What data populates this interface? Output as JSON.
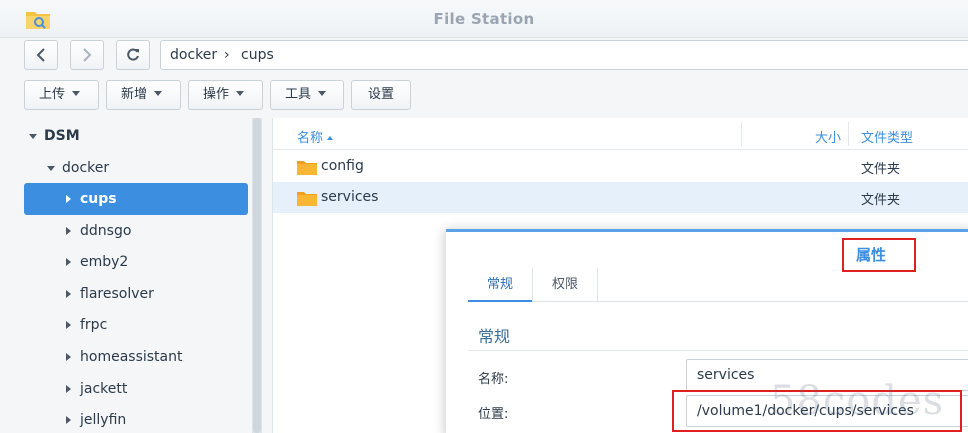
{
  "app": {
    "title": "File Station"
  },
  "nav": {
    "crumbs": [
      "docker",
      "cups"
    ],
    "separator": "›"
  },
  "toolbar": {
    "upload": "上传",
    "create": "新增",
    "action": "操作",
    "tools": "工具",
    "settings": "设置"
  },
  "tree": {
    "root": "DSM",
    "docker": "docker",
    "items": [
      "cups",
      "ddnsgo",
      "emby2",
      "flaresolver",
      "frpc",
      "homeassistant",
      "jackett",
      "jellyfin"
    ]
  },
  "filelist": {
    "headers": {
      "name": "名称",
      "size": "大小",
      "type": "文件类型"
    },
    "rows": [
      {
        "name": "config",
        "type": "文件夹"
      },
      {
        "name": "services",
        "type": "文件夹"
      }
    ]
  },
  "dialog": {
    "title": "属性",
    "tabs": [
      "常规",
      "权限"
    ],
    "section": "常规",
    "name_label": "名称:",
    "name_value": "services",
    "location_label": "位置:",
    "location_value": "/volume1/docker/cups/services"
  },
  "watermark": "58codes",
  "colors": {
    "accent": "#3c8fe0",
    "highlight": "#e02020",
    "folder": "#f5a623"
  }
}
